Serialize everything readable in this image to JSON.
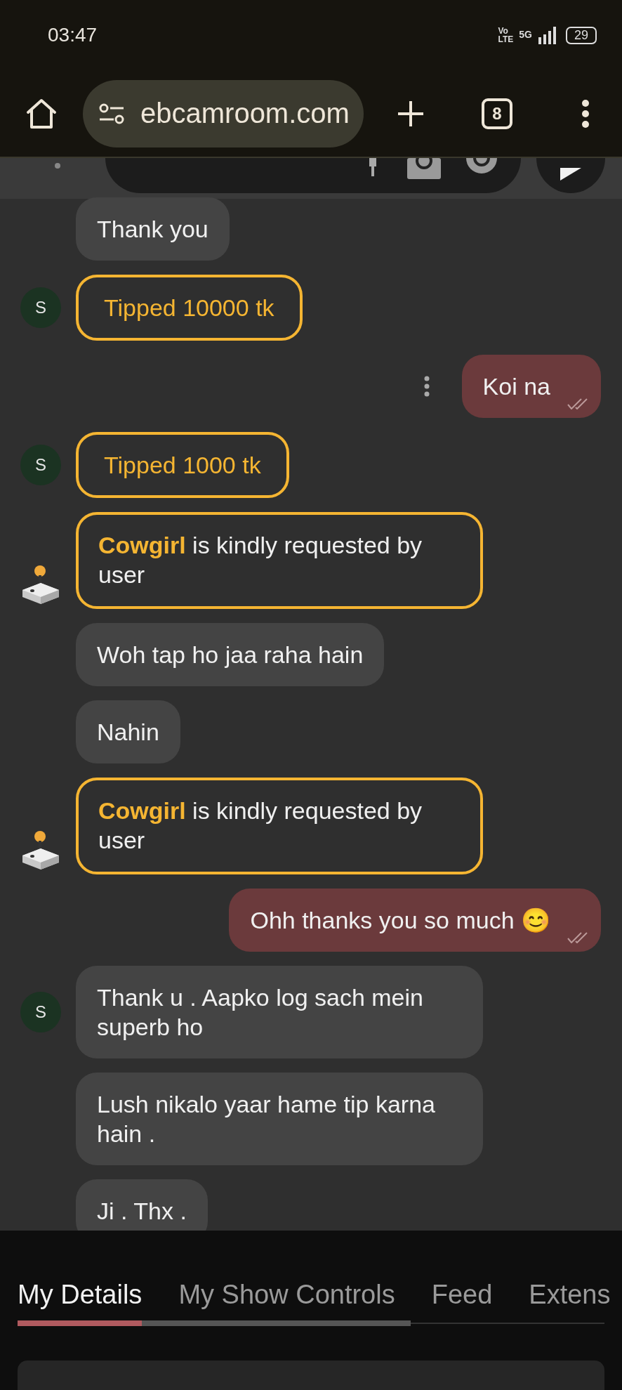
{
  "status_bar": {
    "time": "03:47",
    "network": [
      "Vo",
      "LTE"
    ],
    "signal_label": "5G",
    "battery": "29"
  },
  "browser_toolbar": {
    "url": "ebcamroom.com",
    "tab_count": "8"
  },
  "messages": [
    {
      "kind": "incoming",
      "text": "Thank you"
    },
    {
      "kind": "tip",
      "avatar": {
        "kind": "letter",
        "letter": "S"
      },
      "text": "Tipped 10000 tk"
    },
    {
      "kind": "outgoing",
      "text": "Koi na",
      "menu": true
    },
    {
      "kind": "tip",
      "avatar": {
        "kind": "letter",
        "letter": "S"
      },
      "text": "Tipped 1000 tk"
    },
    {
      "kind": "request",
      "avatar": {
        "kind": "joystick"
      },
      "text": "**Cowgirl** is kindly requested by user"
    },
    {
      "kind": "incoming",
      "text": "Woh tap ho jaa raha hain"
    },
    {
      "kind": "incoming",
      "text": "Nahin"
    },
    {
      "kind": "request",
      "avatar": {
        "kind": "joystick"
      },
      "text": "**Cowgirl** is kindly requested by user"
    },
    {
      "kind": "outgoing",
      "text": "Ohh thanks you so much 😊",
      "menu": false
    },
    {
      "kind": "incoming",
      "avatar": {
        "kind": "letter",
        "letter": "S"
      },
      "text": "Thank u . Aapko log sach mein superb ho"
    },
    {
      "kind": "incoming",
      "text": "Lush nikalo yaar hame tip karna hain ."
    },
    {
      "kind": "incoming",
      "text": "Ji . Thx ."
    }
  ],
  "tabs": [
    {
      "label": "My Details",
      "selected": true
    },
    {
      "label": "My Show Controls",
      "selected": false
    },
    {
      "label": "Feed",
      "selected": false
    },
    {
      "label": "Extens",
      "selected": false
    }
  ]
}
